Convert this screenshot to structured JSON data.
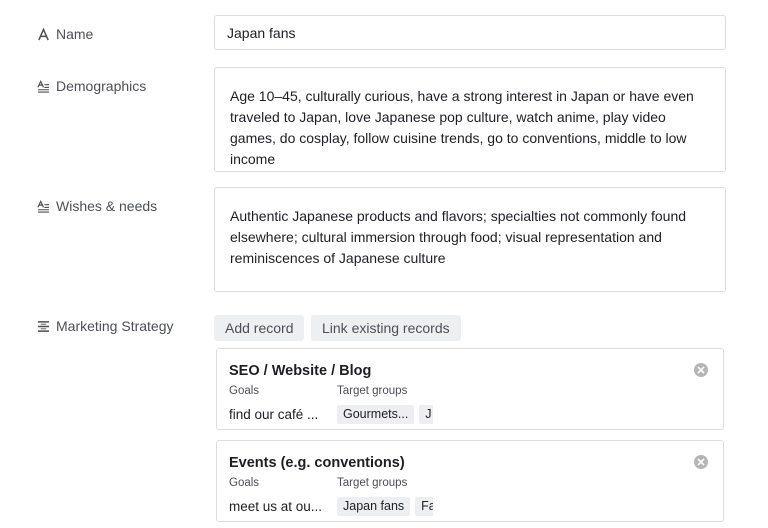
{
  "fields": {
    "name": {
      "label": "Name",
      "icon": "text-field-icon",
      "value": "Japan fans"
    },
    "demographics": {
      "label": "Demographics",
      "icon": "long-text-icon",
      "value": "Age 10–45, culturally curious, have a strong interest in Japan or have even traveled to Japan, love Japanese pop culture, watch anime, play video games, do cosplay, follow cuisine trends, go to conventions, middle to low income"
    },
    "wishes": {
      "label": "Wishes & needs",
      "icon": "long-text-icon",
      "value": "Authentic Japanese products and flavors; specialties not commonly found elsewhere; cultural immersion through food; visual representation and reminiscences of Japanese culture"
    },
    "marketing": {
      "label": "Marketing Strategy",
      "icon": "linked-records-icon",
      "add_label": "Add record",
      "link_label": "Link existing records",
      "records": [
        {
          "title": "SEO / Website / Blog",
          "goals_header": "Goals",
          "targets_header": "Target groups",
          "goals_value": "find our café ...",
          "targets": [
            "Gourmets...",
            "J"
          ]
        },
        {
          "title": "Events (e.g. conventions)",
          "goals_header": "Goals",
          "targets_header": "Target groups",
          "goals_value": "meet us at ou...",
          "targets": [
            "Japan fans",
            "Fa"
          ]
        }
      ]
    }
  }
}
